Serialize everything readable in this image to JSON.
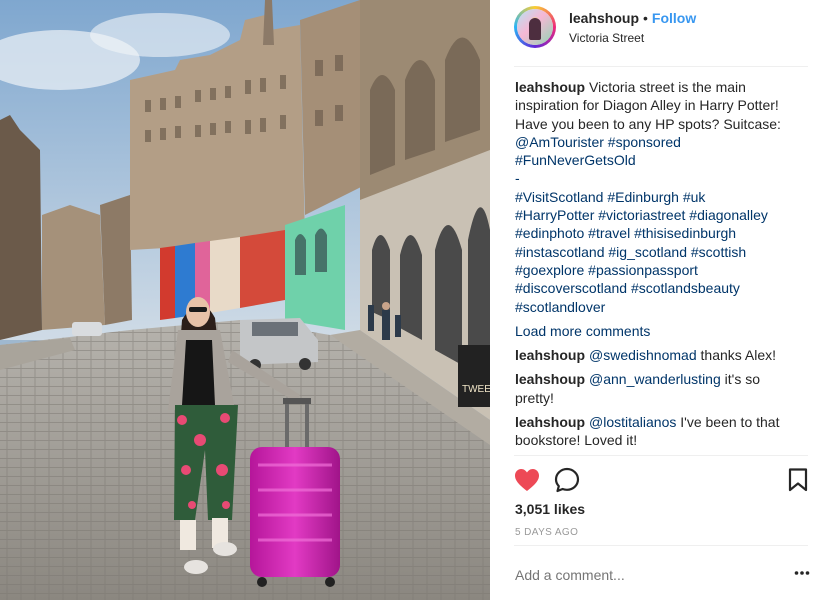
{
  "post": {
    "username": "leahshoup",
    "follow_label": "Follow",
    "separator": "•",
    "location": "Victoria Street",
    "caption_lines": [
      "Victoria street is the main",
      "inspiration for Diagon Alley in Harry Potter!",
      "Have you been to any HP spots? Suitcase:",
      "@AmTourister #sponsored",
      "#FunNeverGetsOld",
      "-",
      "#VisitScotland #Edinburgh #uk",
      "#HarryPotter #victoriastreet #diagonalley",
      "#edinphoto #travel #thisisedinburgh",
      "#instascotland #ig_scotland #scottish",
      "#goexplore #passionpassport",
      "#discoverscotland #scotlandsbeauty",
      "#scotlandlover"
    ],
    "load_more_label": "Load more comments",
    "comments": [
      {
        "username": "leahshoup",
        "mention": "@swedishnomad",
        "text": " thanks Alex!",
        "line2": ""
      },
      {
        "username": "leahshoup",
        "mention": "@ann_wanderlusting",
        "text": " it's so",
        "line2": "pretty!"
      },
      {
        "username": "leahshoup",
        "mention": "@lostitalianos",
        "text": " I've been to that",
        "line2": "bookstore! Loved it!"
      }
    ],
    "likes": "3,051 likes",
    "timestamp": "5 DAYS AGO",
    "add_comment_placeholder": "Add a comment...",
    "liked": true
  },
  "icons": {
    "like": "heart-icon",
    "comment": "comment-icon",
    "save": "bookmark-icon",
    "options": "more-icon"
  },
  "colors": {
    "link": "#003569",
    "follow": "#3897f0",
    "like_red": "#ed4956",
    "muted": "#999999",
    "suitcase": "#d21fae"
  },
  "photo": {
    "shopfront_text": "TWEE"
  }
}
